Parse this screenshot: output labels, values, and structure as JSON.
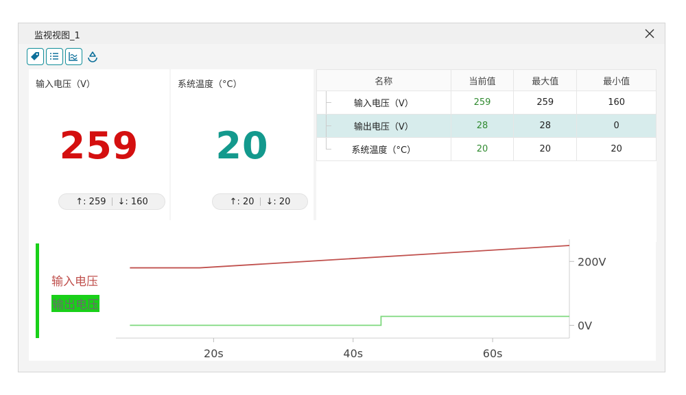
{
  "window": {
    "title": "监视视图_1"
  },
  "toolbar": {
    "icons": [
      "tag-icon",
      "list-icon",
      "trend-icon",
      "cycle-icon"
    ]
  },
  "metrics": [
    {
      "title": "输入电压（V）",
      "value": "259",
      "max": "↑: 259",
      "min": "↓: 160",
      "color": "#d40f0f"
    },
    {
      "title": "系统温度（°C）",
      "value": "20",
      "max": "↑: 20",
      "min": "↓: 20",
      "color": "#13998d"
    }
  ],
  "table": {
    "headers": [
      "名称",
      "当前值",
      "最大值",
      "最小值"
    ],
    "rows": [
      {
        "name": "输入电压（V）",
        "current": "259",
        "max": "259",
        "min": "160",
        "selected": false
      },
      {
        "name": "输出电压（V）",
        "current": "28",
        "max": "28",
        "min": "0",
        "selected": true
      },
      {
        "name": "系统温度（°C）",
        "current": "20",
        "max": "20",
        "min": "20",
        "selected": false
      }
    ]
  },
  "legend": [
    {
      "name": "输入电压",
      "color": "#c0504d"
    },
    {
      "name": "输出电压",
      "color": "#7ed87e"
    }
  ],
  "chart_data": {
    "type": "line",
    "x_ticks": [
      20,
      40,
      60
    ],
    "x_tick_labels": [
      "20s",
      "40s",
      "60s"
    ],
    "xlim": [
      6,
      71
    ],
    "y_ticks": [
      200,
      0
    ],
    "y_tick_labels": [
      "200V",
      "0V"
    ],
    "ylim": [
      -40,
      265
    ],
    "series": [
      {
        "name": "输入电压",
        "color": "#c0504d",
        "x": [
          8,
          18,
          72
        ],
        "y": [
          180,
          180,
          250
        ]
      },
      {
        "name": "输出电压",
        "color": "#7ed87e",
        "x": [
          8,
          44,
          44,
          72
        ],
        "y": [
          0,
          0,
          28,
          28
        ]
      }
    ]
  }
}
